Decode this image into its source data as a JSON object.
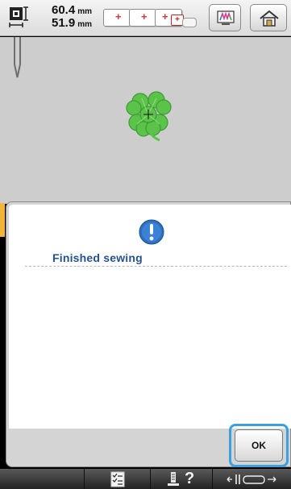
{
  "topbar": {
    "width_value": "60.4",
    "width_unit": "mm",
    "height_value": "51.9",
    "height_unit": "mm",
    "frame_plus": "+"
  },
  "dialog": {
    "message": "Finished sewing",
    "ok_label": "OK"
  },
  "bottombar": {
    "help_label": "?"
  },
  "colors": {
    "clover_green": "#5cc34a",
    "message_blue": "#24528e",
    "highlight_blue": "#3aa0e0",
    "alert_blue": "#2f6fc0"
  }
}
